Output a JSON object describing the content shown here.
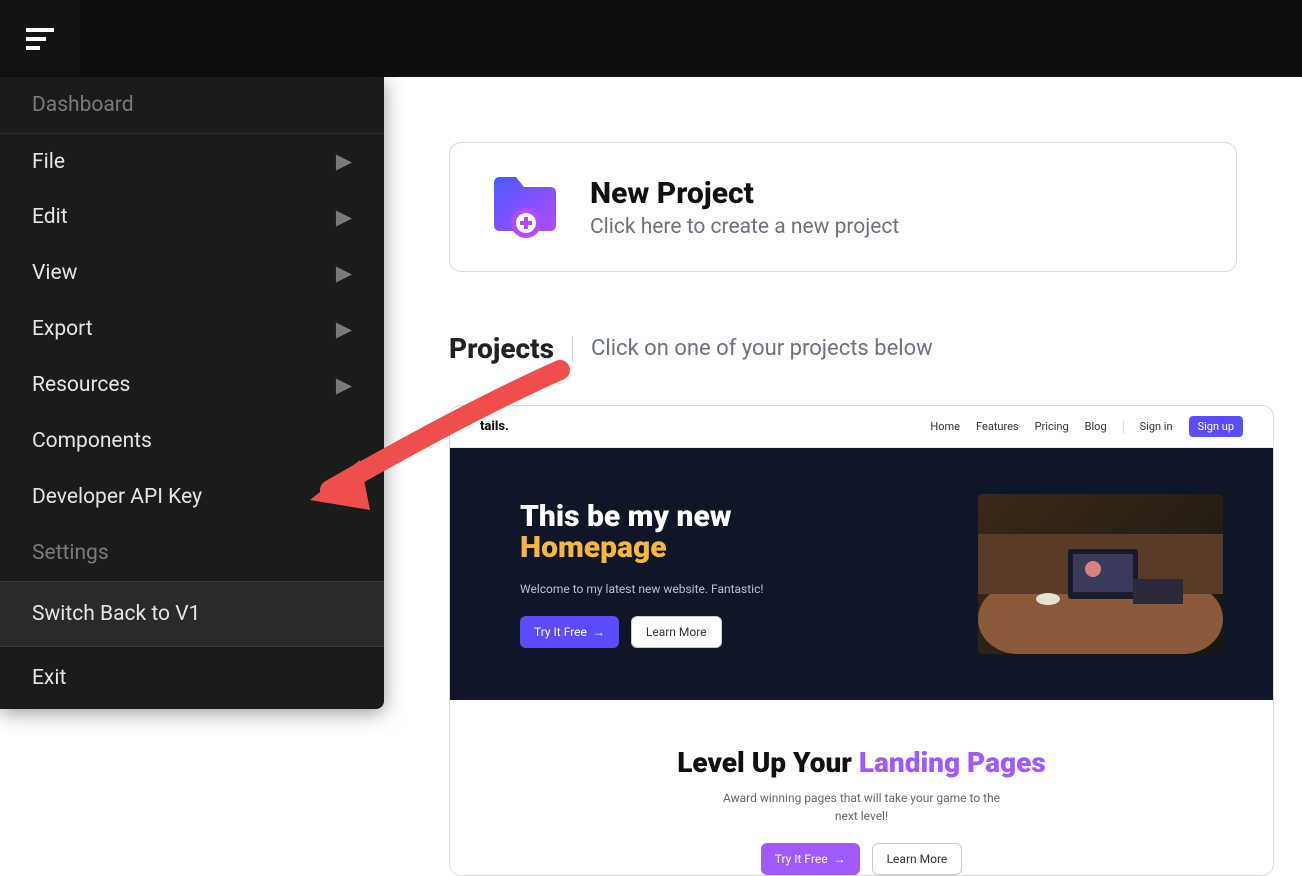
{
  "menu": {
    "dashboard": "Dashboard",
    "file": "File",
    "edit": "Edit",
    "view": "View",
    "export": "Export",
    "resources": "Resources",
    "components": "Components",
    "developer_api_key": "Developer API Key",
    "settings": "Settings",
    "switch_back": "Switch Back to V1",
    "exit": "Exit"
  },
  "new_project": {
    "title": "New Project",
    "subtitle": "Click here to create a new project"
  },
  "projects": {
    "title": "Projects",
    "subtitle": "Click on one of your projects below"
  },
  "preview": {
    "brand": "tails.",
    "nav": {
      "home": "Home",
      "features": "Features",
      "pricing": "Pricing",
      "blog": "Blog",
      "signin": "Sign in",
      "signup": "Sign up"
    },
    "hero": {
      "line1": "This be my new",
      "line2": "Homepage",
      "sub": "Welcome to my latest new website. Fantastic!",
      "cta_primary": "Try It Free",
      "cta_secondary": "Learn More"
    },
    "section2": {
      "line1": "Level Up Your ",
      "line2": "Landing Pages",
      "sub": "Award winning pages that will take your game to the next level!",
      "cta_primary": "Try It Free",
      "cta_secondary": "Learn More"
    }
  }
}
